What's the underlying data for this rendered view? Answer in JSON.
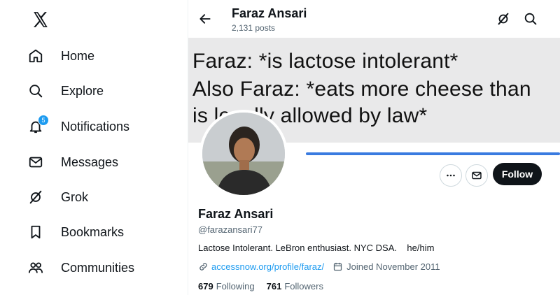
{
  "sidebar": {
    "logo_icon": "x-logo-icon",
    "items": [
      {
        "label": "Home",
        "icon": "home-icon"
      },
      {
        "label": "Explore",
        "icon": "search-icon"
      },
      {
        "label": "Notifications",
        "icon": "bell-icon",
        "badge": "5"
      },
      {
        "label": "Messages",
        "icon": "envelope-icon"
      },
      {
        "label": "Grok",
        "icon": "grok-icon"
      },
      {
        "label": "Bookmarks",
        "icon": "bookmark-icon"
      },
      {
        "label": "Communities",
        "icon": "people-icon"
      }
    ]
  },
  "header": {
    "name": "Faraz Ansari",
    "posts": "2,131 posts"
  },
  "banner": {
    "lines": [
      "Faraz: *is lactose intolerant*",
      "Also Faraz: *eats more cheese than",
      "is legally allowed by law*"
    ]
  },
  "profile": {
    "name": "Faraz Ansari",
    "handle": "@farazansari77",
    "bio": "Lactose Intolerant. LeBron enthusiast. NYC DSA.    he/him",
    "link": "accessnow.org/profile/faraz/",
    "joined": "Joined November 2011",
    "following_count": "679",
    "following_label": "Following",
    "followers_count": "761",
    "followers_label": "Followers",
    "follow_label": "Follow"
  },
  "colors": {
    "accent": "#1d9bf0",
    "text": "#0f1419",
    "muted": "#536471",
    "follow_bg": "#0f1419"
  }
}
